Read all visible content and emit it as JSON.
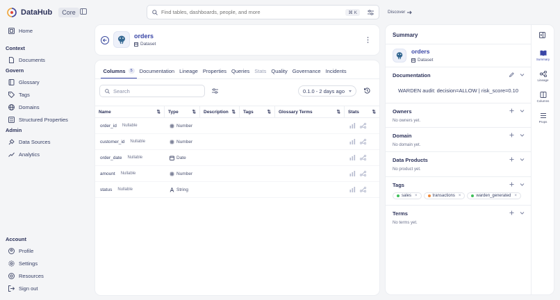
{
  "app": {
    "name": "DataHub",
    "badge": "Core"
  },
  "search": {
    "placeholder": "Find tables, dashboards, people, and more",
    "shortcut": "⌘ K"
  },
  "discover": {
    "label": "Discover"
  },
  "nav": {
    "home": "Home",
    "context_title": "Context",
    "documents": "Documents",
    "govern_title": "Govern",
    "glossary": "Glossary",
    "tags": "Tags",
    "domains": "Domains",
    "structured_properties": "Structured Properties",
    "admin_title": "Admin",
    "data_sources": "Data Sources",
    "analytics": "Analytics",
    "account_title": "Account",
    "profile": "Profile",
    "settings": "Settings",
    "resources": "Resources",
    "sign_out": "Sign out"
  },
  "entity": {
    "name": "orders",
    "type": "Dataset"
  },
  "tabs": [
    {
      "label": "Columns",
      "count": "5"
    },
    {
      "label": "Documentation"
    },
    {
      "label": "Lineage"
    },
    {
      "label": "Properties"
    },
    {
      "label": "Queries"
    },
    {
      "label": "Stats"
    },
    {
      "label": "Quality"
    },
    {
      "label": "Governance"
    },
    {
      "label": "Incidents"
    }
  ],
  "columns_search": {
    "placeholder": "Search"
  },
  "version": {
    "label": "0.1.0 - 2 days ago"
  },
  "table": {
    "headers": [
      "Name",
      "Type",
      "Description",
      "Tags",
      "Glossary Terms",
      "Stats"
    ],
    "rows": [
      {
        "name": "order_id",
        "nullable": "Nullable",
        "type": "Number",
        "type_icon": "hash-icon"
      },
      {
        "name": "customer_id",
        "nullable": "Nullable",
        "type": "Number",
        "type_icon": "hash-icon"
      },
      {
        "name": "order_date",
        "nullable": "Nullable",
        "type": "Date",
        "type_icon": "calendar-icon"
      },
      {
        "name": "amount",
        "nullable": "Nullable",
        "type": "Number",
        "type_icon": "hash-icon"
      },
      {
        "name": "status",
        "nullable": "Nullable",
        "type": "String",
        "type_icon": "string-icon"
      }
    ]
  },
  "summary": {
    "title": "Summary",
    "entity_name": "orders",
    "entity_type": "Dataset",
    "documentation_title": "Documentation",
    "documentation_text": "WARDEN audit: decision=ALLOW | risk_score=0.10",
    "owners_title": "Owners",
    "owners_empty": "No owners yet.",
    "domain_title": "Domain",
    "domain_empty": "No domain yet.",
    "data_products_title": "Data Products",
    "data_products_empty": "No product yet.",
    "tags_title": "Tags",
    "tags": [
      {
        "label": "sales",
        "color": "#3fbf5a"
      },
      {
        "label": "transactions",
        "color": "#f08a3a"
      },
      {
        "label": "warden_generated",
        "color": "#3fbf5a"
      }
    ],
    "terms_title": "Terms",
    "terms_empty": "No terms yet."
  },
  "rail": {
    "summary": "Summary",
    "lineage": "Lineage",
    "columns": "Columns",
    "props": "Props"
  },
  "colors": {
    "accent": "#3a46a6",
    "text": "#374066",
    "background": "#f4f5f7"
  }
}
